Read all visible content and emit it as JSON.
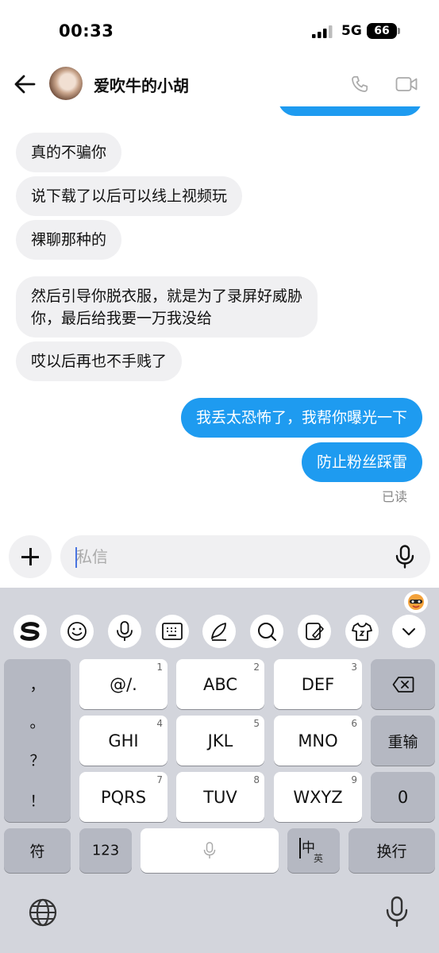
{
  "status_bar": {
    "time": "00:33",
    "network": "5G",
    "battery": "66"
  },
  "header": {
    "contact_name": "爱吹牛的小胡"
  },
  "messages": [
    {
      "text": "真的不骗你",
      "direction": "in"
    },
    {
      "text": "说下载了以后可以线上视频玩",
      "direction": "in"
    },
    {
      "text": "裸聊那种的",
      "direction": "in"
    },
    {
      "text_lines": [
        "然后引导你脱衣服，就是为了录屏好威胁",
        "你，最后给我要一万我没给"
      ],
      "direction": "in"
    },
    {
      "text": "哎以后再也不手贱了",
      "direction": "in"
    },
    {
      "text": "我丢太恐怖了，我帮你曝光一下",
      "direction": "out"
    },
    {
      "text": "防止粉丝踩雷",
      "direction": "out"
    }
  ],
  "read_status": "已读",
  "input": {
    "placeholder": "私信"
  },
  "keyboard": {
    "toolbar_icons": [
      "sogou-logo-icon",
      "emoji-icon",
      "voice-icon",
      "keyboard-icon",
      "handwriting-icon",
      "search-icon",
      "edit-icon",
      "skin-icon",
      "chevron-down-icon"
    ],
    "punctuation": [
      "，",
      "。",
      "？",
      "！"
    ],
    "keys": {
      "k1": {
        "label": "@/.",
        "num": "1"
      },
      "k2": {
        "label": "ABC",
        "num": "2"
      },
      "k3": {
        "label": "DEF",
        "num": "3"
      },
      "k4": {
        "label": "GHI",
        "num": "4"
      },
      "k5": {
        "label": "JKL",
        "num": "5"
      },
      "k6": {
        "label": "MNO",
        "num": "6"
      },
      "k7": {
        "label": "PQRS",
        "num": "7"
      },
      "k8": {
        "label": "TUV",
        "num": "8"
      },
      "k9": {
        "label": "WXYZ",
        "num": "9"
      }
    },
    "retype": "重输",
    "zero": "0",
    "symbols": "符",
    "numbers": "123",
    "lang_main": "中",
    "lang_sub": "英",
    "newline": "换行"
  }
}
